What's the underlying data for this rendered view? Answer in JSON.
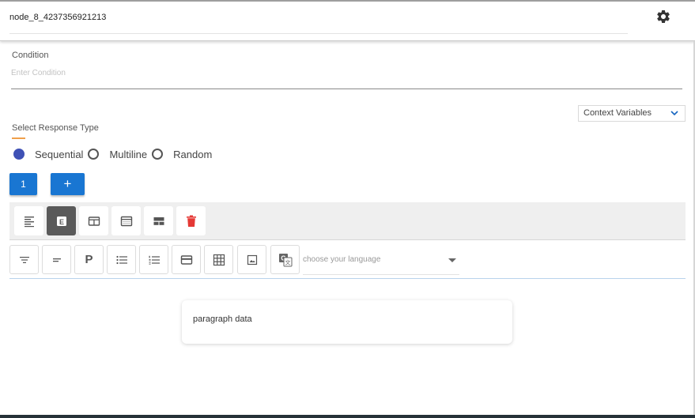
{
  "header": {
    "node_title": "node_8_4237356921213",
    "settings_icon": "gear-icon"
  },
  "condition": {
    "label": "Condition",
    "placeholder": "Enter Condition",
    "value": ""
  },
  "context_variables": {
    "selected": "Context Variables",
    "icon": "chevron-down-icon"
  },
  "response_type": {
    "label": "Select Response Type",
    "options": [
      {
        "label": "Sequential",
        "checked": true
      },
      {
        "label": "Multiline",
        "checked": false
      },
      {
        "label": "Random",
        "checked": false
      }
    ]
  },
  "responses": {
    "tab_label": "1",
    "add_label": "+"
  },
  "template_toolbar": {
    "items": [
      {
        "icon": "align-left-icon"
      },
      {
        "icon": "e-badge-icon",
        "label": "E",
        "active": true
      },
      {
        "icon": "card-template-icon"
      },
      {
        "icon": "carousel-template-icon"
      },
      {
        "icon": "list-template-icon"
      },
      {
        "icon": "delete-icon"
      }
    ]
  },
  "format_toolbar": {
    "items": [
      {
        "icon": "filter-lines-icon"
      },
      {
        "icon": "short-text-icon"
      },
      {
        "icon": "paragraph-icon",
        "label": "P"
      },
      {
        "icon": "bulleted-list-icon"
      },
      {
        "icon": "numbered-list-icon"
      },
      {
        "icon": "card-icon"
      },
      {
        "icon": "table-icon"
      },
      {
        "icon": "image-icon"
      },
      {
        "icon": "translate-icon"
      }
    ],
    "language_placeholder": "choose your language"
  },
  "content_card": {
    "text": "paragraph data"
  },
  "colors": {
    "primary_blue": "#1976d2",
    "radio_checked": "#3f51b5",
    "accent_orange": "#f0a04b",
    "delete_red": "#e53935",
    "active_tool": "#5a5a5a"
  }
}
